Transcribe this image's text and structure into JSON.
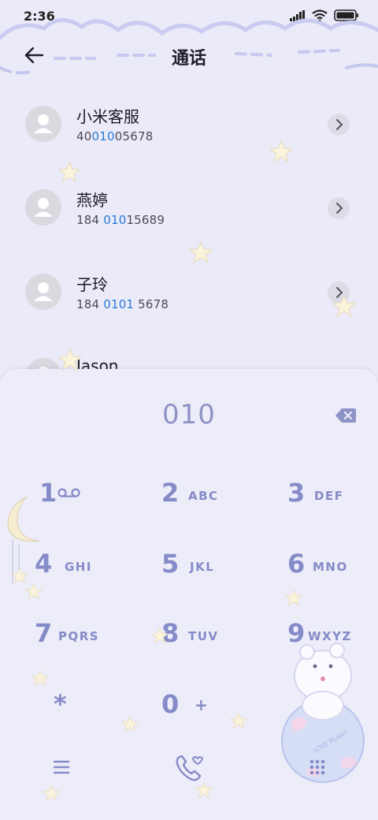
{
  "status_bar": {
    "time": "2:36"
  },
  "header": {
    "title": "通话"
  },
  "contacts": [
    {
      "name": "小米客服",
      "number_pre": "40",
      "number_hl": "010",
      "number_post": "05678"
    },
    {
      "name": "燕婷",
      "number_pre": "184 ",
      "number_hl": "010",
      "number_post": "15689"
    },
    {
      "name": "子玲",
      "number_pre": "184 ",
      "number_hl": "0101",
      "number_post": " 5678"
    },
    {
      "name": "Jason",
      "number_pre": "",
      "number_hl": "",
      "number_post": ""
    }
  ],
  "dialpad": {
    "entered": "010",
    "keys": [
      {
        "num": "1",
        "letters": ""
      },
      {
        "num": "2",
        "letters": "ABC"
      },
      {
        "num": "3",
        "letters": "DEF"
      },
      {
        "num": "4",
        "letters": "GHI"
      },
      {
        "num": "5",
        "letters": "JKL"
      },
      {
        "num": "6",
        "letters": "MNO"
      },
      {
        "num": "7",
        "letters": "PQRS"
      },
      {
        "num": "8",
        "letters": "TUV"
      },
      {
        "num": "9",
        "letters": "WXYZ"
      },
      {
        "num": "*",
        "letters": ""
      },
      {
        "num": "0",
        "letters": "+"
      },
      {
        "num": "#",
        "letters": ""
      }
    ]
  },
  "decoration": {
    "planet_text": "LOVE PLANT"
  },
  "colors": {
    "accent": "#858bc8",
    "highlight": "#2a7bd6",
    "background": "#ebeaf8"
  },
  "icons": [
    "back-arrow-icon",
    "chevron-right-icon",
    "backspace-icon",
    "voicemail-icon",
    "menu-icon",
    "phone-call-icon",
    "dialpad-grid-icon"
  ]
}
